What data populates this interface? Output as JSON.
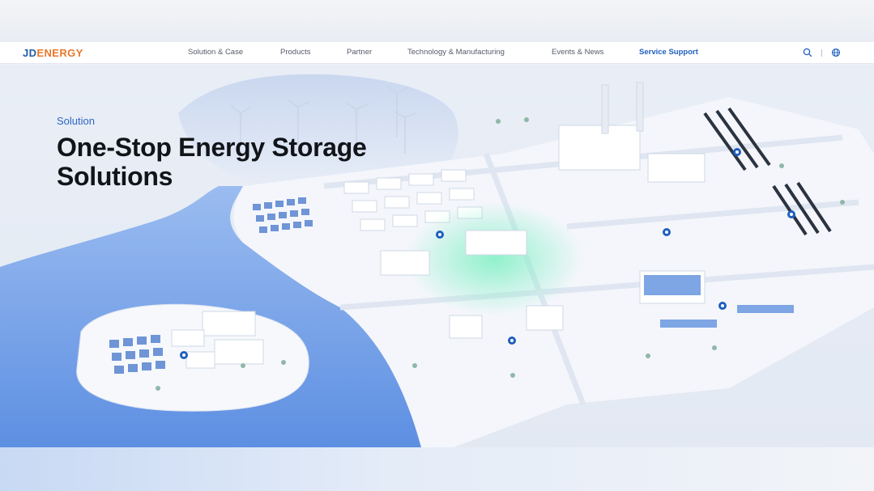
{
  "brand": {
    "logo_text_a": "JD",
    "logo_text_b": "ENERGY"
  },
  "nav": {
    "items": [
      {
        "label": "Solution & Case"
      },
      {
        "label": "Products"
      },
      {
        "label": "Partner"
      },
      {
        "label": "Technology & Manufacturing"
      },
      {
        "label": "Events & News"
      },
      {
        "label": "Service Support"
      }
    ],
    "active_index": 5
  },
  "tools": {
    "search_icon": "search-icon",
    "language_icon": "globe-icon"
  },
  "hero": {
    "kicker": "Solution",
    "title_line1": "One-Stop Energy Storage",
    "title_line2": "Solutions"
  },
  "colors": {
    "accent": "#1f5fbf",
    "logo_blue": "#1f5fa8",
    "logo_orange": "#e8782a",
    "water": "#7fa6e6",
    "glow": "#5fe3b0"
  }
}
